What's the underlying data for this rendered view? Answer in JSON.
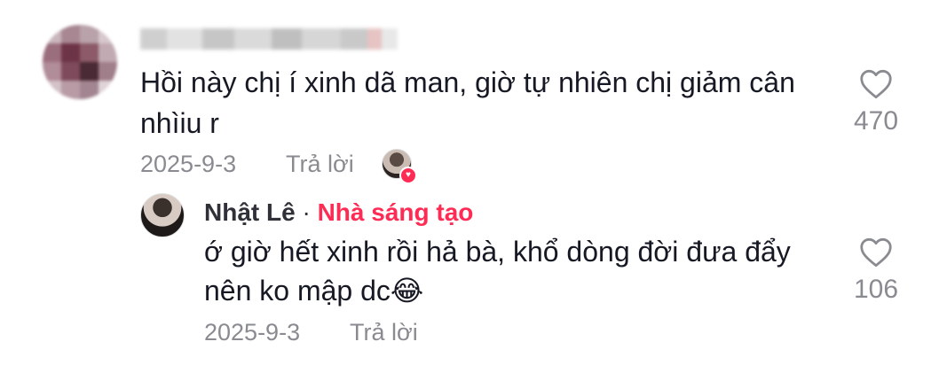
{
  "comment": {
    "text": "Hồi này chị í xinh dã man, giờ tự nhiên chị giảm cân nhìiu r",
    "date": "2025-9-3",
    "reply_label": "Trả lời",
    "likes": "470"
  },
  "reply": {
    "author": "Nhật Lê",
    "separator": "·",
    "badge": "Nhà sáng tạo",
    "text": "ớ giờ hết xinh rồi hả bà, khổ dòng đời đưa đẩy nên ko mập dc😂",
    "date": "2025-9-3",
    "reply_label": "Trả lời",
    "likes": "106"
  },
  "icons": {
    "like": "heart-outline-icon",
    "creator_liked": "heart-badge-icon"
  },
  "colors": {
    "text": "#161823",
    "muted": "#8a8b91",
    "accent": "#fe2c55"
  }
}
